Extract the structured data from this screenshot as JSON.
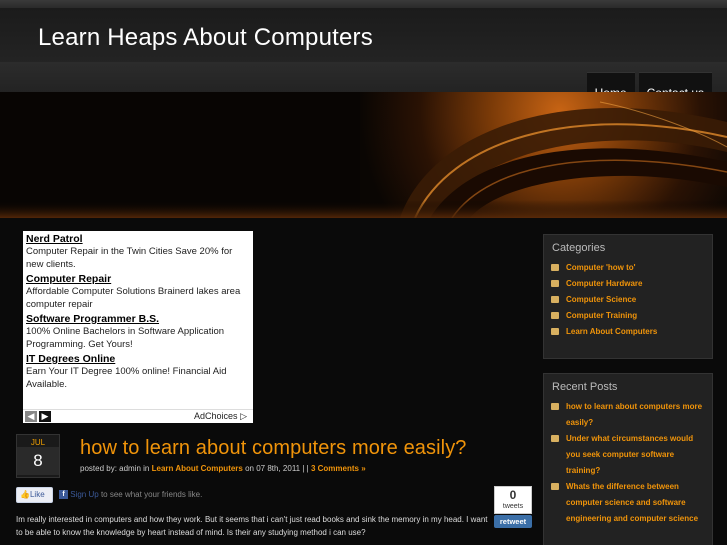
{
  "site": {
    "title": "Learn Heaps About Computers"
  },
  "nav": [
    {
      "label": "Home"
    },
    {
      "label": "Contact us"
    }
  ],
  "ads": {
    "items": [
      {
        "title": "Nerd Patrol",
        "body": "Computer Repair in the Twin Cities Save 20% for new clients."
      },
      {
        "title": "Computer Repair",
        "body": "Affordable Computer Solutions Brainerd lakes area computer repair"
      },
      {
        "title": "Software Programmer B.S.",
        "body": "100% Online Bachelors in Software Application Programming. Get Yours!"
      },
      {
        "title": "IT Degrees Online",
        "body": "Earn Your IT Degree 100% online! Financial Aid Available."
      }
    ],
    "adchoices_label": "AdChoices"
  },
  "post": {
    "date_month": "JUL",
    "date_day": "8",
    "title": "how to learn about computers more easily?",
    "meta_prefix": "posted by: admin in",
    "meta_category": "Learn About Computers",
    "meta_date": "on 07 8th, 2011 | |",
    "meta_comments": "3 Comments »",
    "like_label": "Like",
    "signup_link": "Sign Up",
    "signup_text": "to see what your friends like.",
    "tweet_count": "0",
    "tweet_label": "tweets",
    "retweet_label": "retweet",
    "body": "Im really interested in computers and how they work. But it seems that i can't just read books and sink the memory in my head. I want to be able to know the knowledge by heart instead of mind. Is their any studying method i can use?"
  },
  "sidebar": {
    "categories": {
      "heading": "Categories",
      "items": [
        {
          "label": "Computer 'how to'"
        },
        {
          "label": "Computer Hardware"
        },
        {
          "label": "Computer Science"
        },
        {
          "label": "Computer Training"
        },
        {
          "label": "Learn About Computers"
        }
      ]
    },
    "recent_posts": {
      "heading": "Recent Posts",
      "items": [
        {
          "label": "how to learn about computers more easily?"
        },
        {
          "label": "Under what circumstances would you seek computer software training?"
        },
        {
          "label": "Whats the difference between computer science and software engineering and computer science"
        }
      ]
    }
  },
  "colors": {
    "accent": "#f0940a",
    "background": "#000000"
  }
}
